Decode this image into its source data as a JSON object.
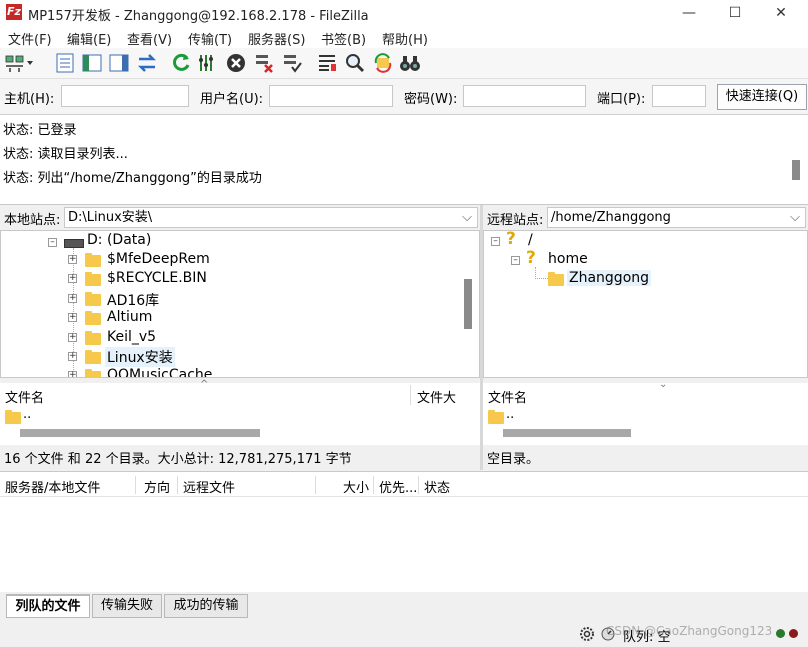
{
  "window": {
    "title": "MP157开发板 - Zhanggong@192.168.2.178 - FileZilla",
    "app_icon": "Fz",
    "minimize_icon": "—",
    "maximize_icon": "☐",
    "close_icon": "✕"
  },
  "menu": [
    "文件(F)",
    "编辑(E)",
    "查看(V)",
    "传输(T)",
    "服务器(S)",
    "书签(B)",
    "帮助(H)"
  ],
  "quickconnect": {
    "host_label": "主机(H):",
    "user_label": "用户名(U):",
    "pass_label": "密码(W):",
    "port_label": "端口(P):",
    "connect_button": "快速连接(Q)",
    "host_value": "",
    "user_value": "",
    "pass_value": "",
    "port_value": ""
  },
  "log": [
    "状态: 已登录",
    "状态: 读取目录列表...",
    "状态: 列出“/home/Zhanggong”的目录成功"
  ],
  "local": {
    "label": "本地站点:",
    "path": "D:\\Linux安装\\",
    "drive": "D: (Data)",
    "tree": [
      "$MfeDeepRem",
      "$RECYCLE.BIN",
      "AD16库",
      "Altium",
      "Keil_v5",
      "Linux安装",
      "QQMusicCache"
    ],
    "selected": "Linux安装",
    "col_name": "文件名",
    "col_size": "文件大",
    "parent_dir": "..",
    "status": "16 个文件 和 22 个目录。大小总计: 12,781,275,171 字节"
  },
  "remote": {
    "label": "远程站点:",
    "path": "/home/Zhanggong",
    "tree": [
      {
        "name": "/",
        "icon": "question"
      },
      {
        "name": "home",
        "icon": "question"
      },
      {
        "name": "Zhanggong",
        "icon": "folder"
      }
    ],
    "col_name": "文件名",
    "parent_dir": "..",
    "status": "空目录。"
  },
  "queue": {
    "columns": [
      "服务器/本地文件",
      "方向",
      "远程文件",
      "大小",
      "优先...",
      "状态"
    ],
    "tabs": [
      "列队的文件",
      "传输失败",
      "成功的传输"
    ],
    "active_tab": "列队的文件"
  },
  "statusbar": {
    "queue_text": "队列: 空",
    "watermark": "CSDN @CaoZhangGong123"
  },
  "colors": {
    "accent": "#c62828",
    "folder": "#f6c84c",
    "question": "#e6a800",
    "selection": "#e5f1fb"
  }
}
